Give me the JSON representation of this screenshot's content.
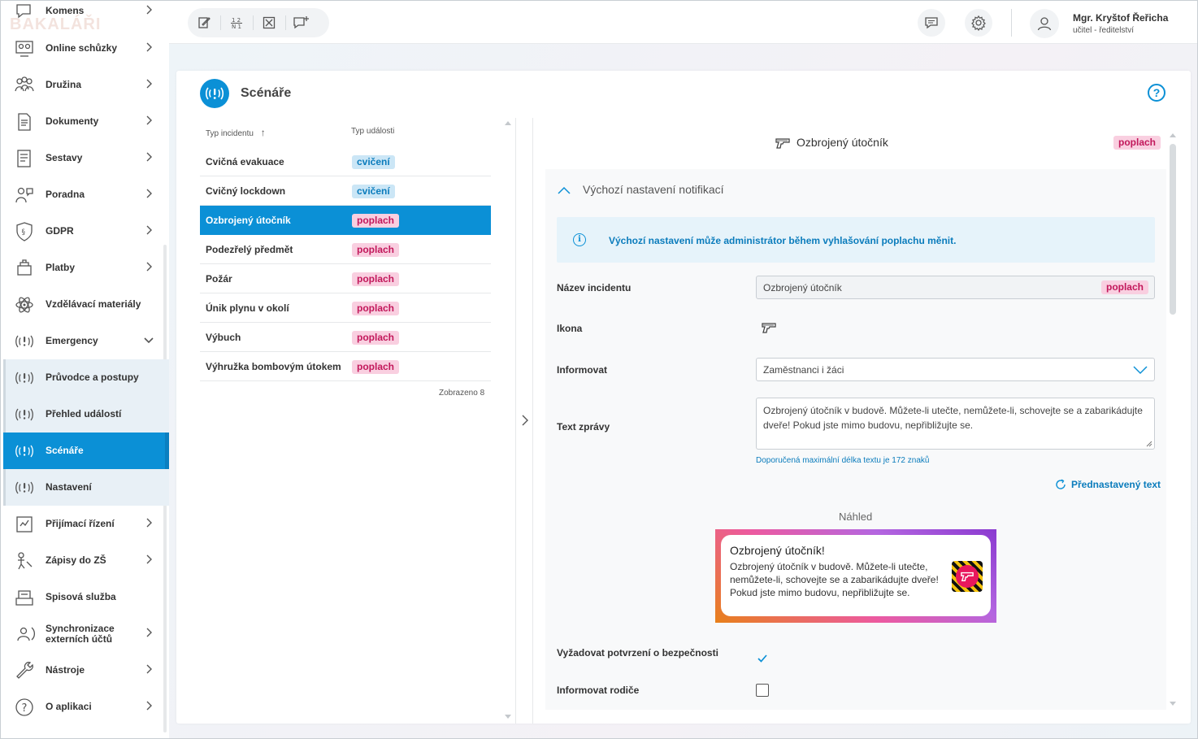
{
  "topbar": {
    "user_name": "Mgr. Kryštof Řeřicha",
    "user_role": "učitel - ředitelství"
  },
  "sidebar": {
    "watermark": "BAKALÁŘI",
    "items": [
      {
        "label": "Komens",
        "icon": "chat-icon"
      },
      {
        "label": "Online schůzky",
        "icon": "video-call-icon"
      },
      {
        "label": "Družina",
        "icon": "group-icon"
      },
      {
        "label": "Dokumenty",
        "icon": "document-icon"
      },
      {
        "label": "Sestavy",
        "icon": "report-icon"
      },
      {
        "label": "Poradna",
        "icon": "counsel-icon"
      },
      {
        "label": "GDPR",
        "icon": "shield-icon"
      },
      {
        "label": "Platby",
        "icon": "payment-icon"
      },
      {
        "label": "Vzdělávací materiály",
        "icon": "atom-icon"
      },
      {
        "label": "Emergency",
        "icon": "emergency-icon"
      },
      {
        "label": "Průvodce a postupy",
        "icon": "emergency-guide-icon"
      },
      {
        "label": "Přehled událostí",
        "icon": "emergency-events-icon"
      },
      {
        "label": "Scénáře",
        "icon": "emergency-scenarios-icon"
      },
      {
        "label": "Nastavení",
        "icon": "emergency-settings-icon"
      },
      {
        "label": "Přijímací řízení",
        "icon": "admission-icon"
      },
      {
        "label": "Zápisy do ZŠ",
        "icon": "enrollment-icon"
      },
      {
        "label": "Spisová služba",
        "icon": "archive-icon"
      },
      {
        "label": "Synchronizace externích účtů",
        "icon": "sync-icon"
      },
      {
        "label": "Nástroje",
        "icon": "wrench-icon"
      },
      {
        "label": "O aplikaci",
        "icon": "question-icon"
      }
    ]
  },
  "page": {
    "title": "Scénáře",
    "help": "?"
  },
  "list": {
    "col_type": "Typ incidentu",
    "col_event": "Typ události",
    "rows": [
      {
        "name": "Cvičná evakuace",
        "badge": "cvičení",
        "kind": "cviceni"
      },
      {
        "name": "Cvičný lockdown",
        "badge": "cvičení",
        "kind": "cviceni"
      },
      {
        "name": "Ozbrojený útočník",
        "badge": "poplach",
        "kind": "poplach"
      },
      {
        "name": "Podezřelý předmět",
        "badge": "poplach",
        "kind": "poplach"
      },
      {
        "name": "Požár",
        "badge": "poplach",
        "kind": "poplach"
      },
      {
        "name": "Únik plynu v okolí",
        "badge": "poplach",
        "kind": "poplach"
      },
      {
        "name": "Výbuch",
        "badge": "poplach",
        "kind": "poplach"
      },
      {
        "name": "Výhružka bombovým útokem",
        "badge": "poplach",
        "kind": "poplach"
      }
    ],
    "selected_index": 2,
    "shown": "Zobrazeno 8"
  },
  "detail": {
    "title": "Ozbrojený útočník",
    "badge": "poplach",
    "section_title": "Výchozí nastavení notifikací",
    "info": "Výchozí nastavení může administrátor během vyhlašování poplachu měnit.",
    "fields": {
      "name_label": "Název incidentu",
      "name_value": "Ozbrojený útočník",
      "name_badge": "poplach",
      "icon_label": "Ikona",
      "inform_label": "Informovat",
      "inform_value": "Zaměstnanci i žáci",
      "message_label": "Text zprávy",
      "message_value": "Ozbrojený útočník v budově. Můžete-li utečte, nemůžete-li, schovejte se a zabarikádujte dveře! Pokud jste mimo budovu, nepřibližujte se.",
      "hint": "Doporučená maximální délka textu je 172 znaků",
      "preset": "Přednastavený text",
      "preview_label": "Náhled",
      "preview_title": "Ozbrojený útočník!",
      "preview_body": "Ozbrojený útočník v budově. Můžete-li utečte, nemůžete-li, schovejte se a zabarikádujte dveře! Pokud jste mimo budovu, nepřibližujte se.",
      "confirm_label": "Vyžadovat potvrzení o bezpečnosti",
      "confirm_checked": true,
      "parents_label": "Informovat rodiče",
      "parents_checked": false
    }
  },
  "colors": {
    "accent": "#0b90d6",
    "cviceni_bg": "#cbe6f6",
    "poplach_bg": "#f9cfe0"
  }
}
